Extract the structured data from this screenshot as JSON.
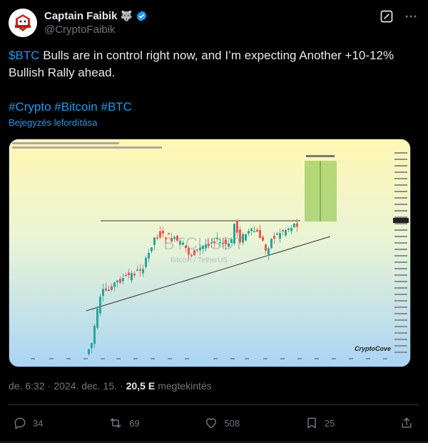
{
  "author": {
    "name": "Captain Faibik",
    "handle": "@CryptoFaibik",
    "emoji": "🐺"
  },
  "tweet": {
    "cashtag": "$BTC",
    "text": " Bulls are in control right now, and I’m expecting Another +10-12% Bullish Rally ahead.",
    "hashtags": [
      "#Crypto",
      "#Bitcoin",
      "#BTC"
    ],
    "translate_label": "Bejegyzés lefordítása"
  },
  "chart_image": {
    "watermark": "BTCUSDT",
    "watermark_sub": "Bitcoin / TetherUS",
    "brand": "CryptoCove"
  },
  "meta": {
    "time": "de. 6:32",
    "date": "2024. dec. 15.",
    "dot": "·",
    "views_count": "20,5 E",
    "views_label": "megtekintés"
  },
  "actions": {
    "replies": "34",
    "reposts": "69",
    "likes": "508",
    "bookmarks": "25"
  },
  "colors": {
    "accent": "#1d9bf0",
    "up_candle": "#26a69a",
    "down_candle": "#ef5350",
    "target_box": "#8bc34a"
  }
}
